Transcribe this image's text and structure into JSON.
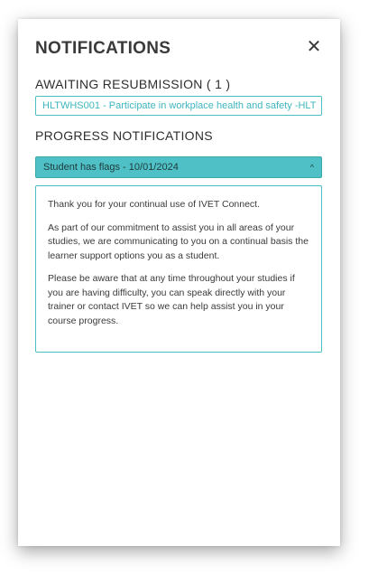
{
  "panel": {
    "title": "NOTIFICATIONS",
    "close_icon": "close-icon",
    "close_glyph": "✕"
  },
  "awaiting": {
    "heading": "AWAITING RESUBMISSION ( 1 )",
    "items": [
      {
        "label": "HLTWHS001 - Participate in workplace health and safety -HLT"
      }
    ]
  },
  "progress": {
    "heading": "PROGRESS NOTIFICATIONS",
    "items": [
      {
        "title": "Student has flags - 10/01/2024",
        "chevron_icon": "chevron-up-icon",
        "chevron_glyph": "^",
        "expanded": true,
        "paragraphs": [
          "Thank you for your continual use of IVET Connect.",
          "As part of our commitment to assist you in all areas of your studies, we are communicating to you on a continual basis the learner support options you as a student.",
          "Please be aware that at any time throughout your studies if you are having difficulty, you can speak directly with your trainer or contact IVET so we can help assist you in your course progress."
        ]
      }
    ]
  },
  "colors": {
    "accent": "#4fc1c6",
    "accent_border": "#4bbec4",
    "link_text": "#3fb6bd",
    "heading_text": "#3a3a3a"
  }
}
